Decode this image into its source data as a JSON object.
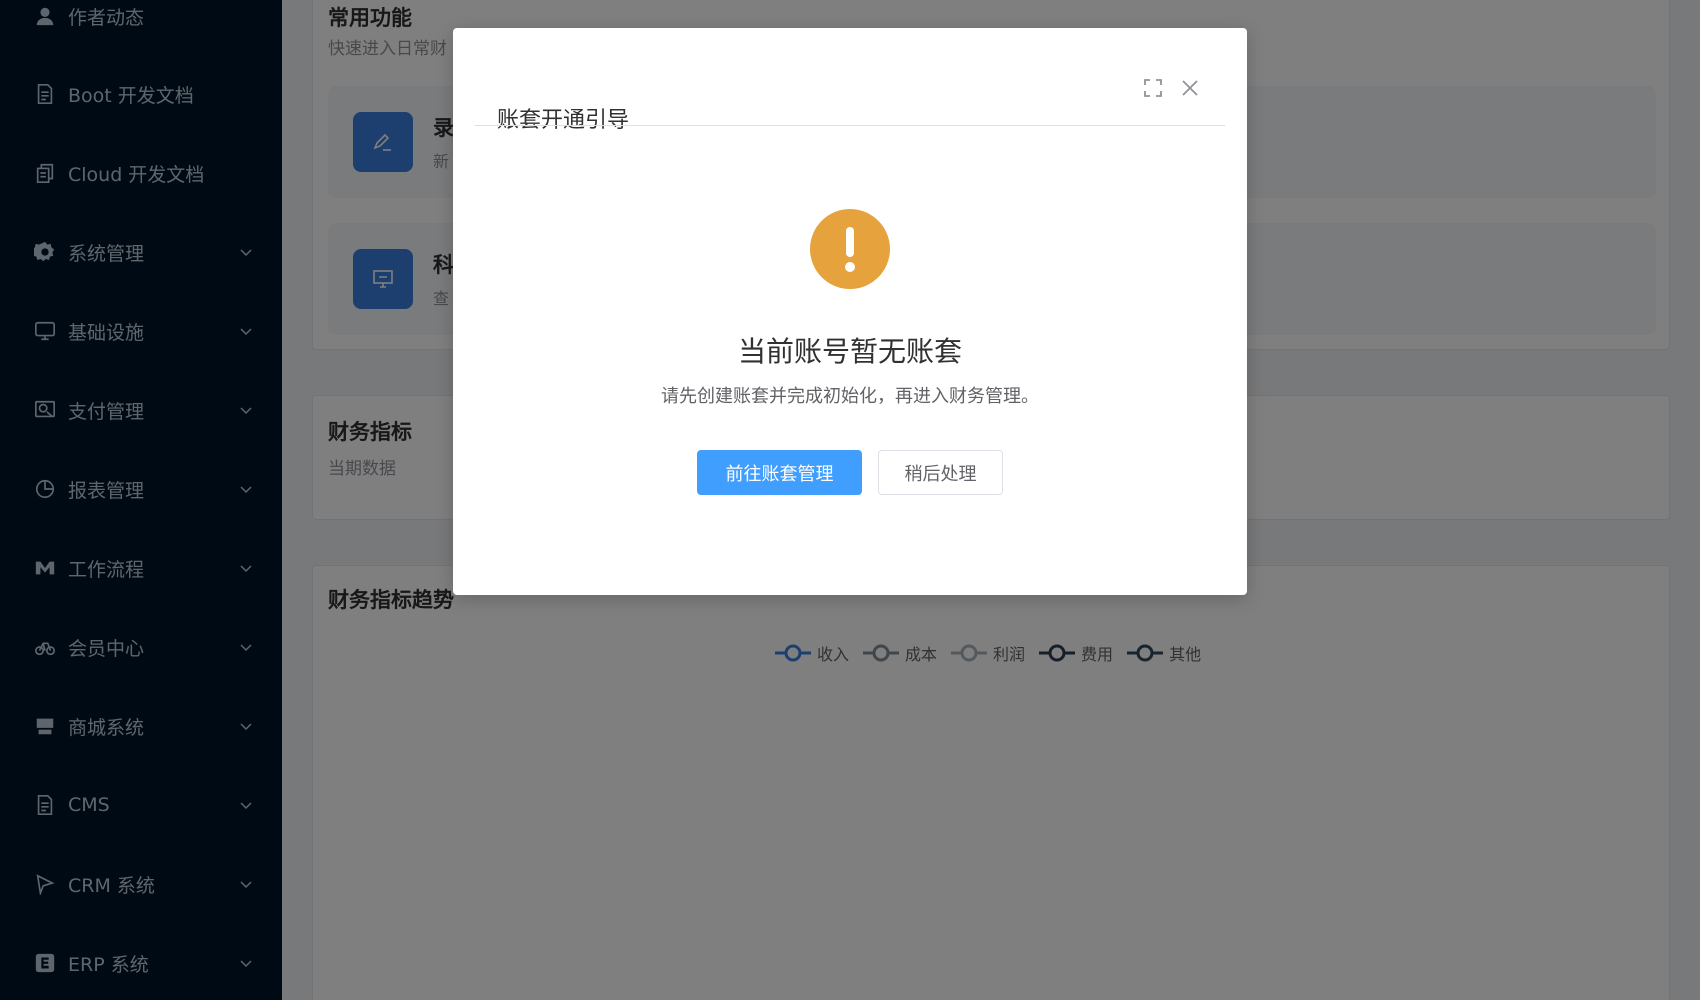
{
  "sidebar": {
    "items": [
      {
        "label": "作者动态",
        "icon": "user-icon"
      },
      {
        "label": "Boot 开发文档",
        "icon": "document-icon"
      },
      {
        "label": "Cloud 开发文档",
        "icon": "copy-document-icon"
      },
      {
        "label": "系统管理",
        "icon": "gear-icon",
        "expandable": true
      },
      {
        "label": "基础设施",
        "icon": "monitor-icon",
        "expandable": true
      },
      {
        "label": "支付管理",
        "icon": "payment-icon",
        "expandable": true
      },
      {
        "label": "报表管理",
        "icon": "pie-chart-icon",
        "expandable": true
      },
      {
        "label": "工作流程",
        "icon": "workflow-icon",
        "expandable": true
      },
      {
        "label": "会员中心",
        "icon": "bicycle-icon",
        "expandable": true
      },
      {
        "label": "商城系统",
        "icon": "shop-icon",
        "expandable": true
      },
      {
        "label": "CMS",
        "icon": "document-icon",
        "expandable": true
      },
      {
        "label": "CRM 系统",
        "icon": "flag-icon",
        "expandable": true
      },
      {
        "label": "ERP 系统",
        "icon": "erp-icon",
        "expandable": true
      }
    ]
  },
  "main": {
    "quick": {
      "title": "常用功能",
      "subtitle": "快速进入日常财",
      "items": [
        {
          "name": "录",
          "desc": "新",
          "icon": "edit-icon"
        },
        {
          "name": "科",
          "desc": "查",
          "icon": "presentation-icon"
        }
      ]
    },
    "indicators": {
      "title": "财务指标",
      "subtitle": "当期数据"
    },
    "trend": {
      "title": "财务指标趋势",
      "legend": [
        "收入",
        "成本",
        "利润",
        "费用",
        "其他"
      ]
    }
  },
  "dialog": {
    "title": "账套开通引导",
    "heading": "当前账号暂无账套",
    "description": "请先创建账套并完成初始化，再进入财务管理。",
    "primary_button": "前往账套管理",
    "secondary_button": "稍后处理"
  },
  "colors": {
    "sidebar_bg": "#001529",
    "primary": "#409eff",
    "warning": "#e6a23c",
    "legend_active": "#3a7ee0"
  }
}
